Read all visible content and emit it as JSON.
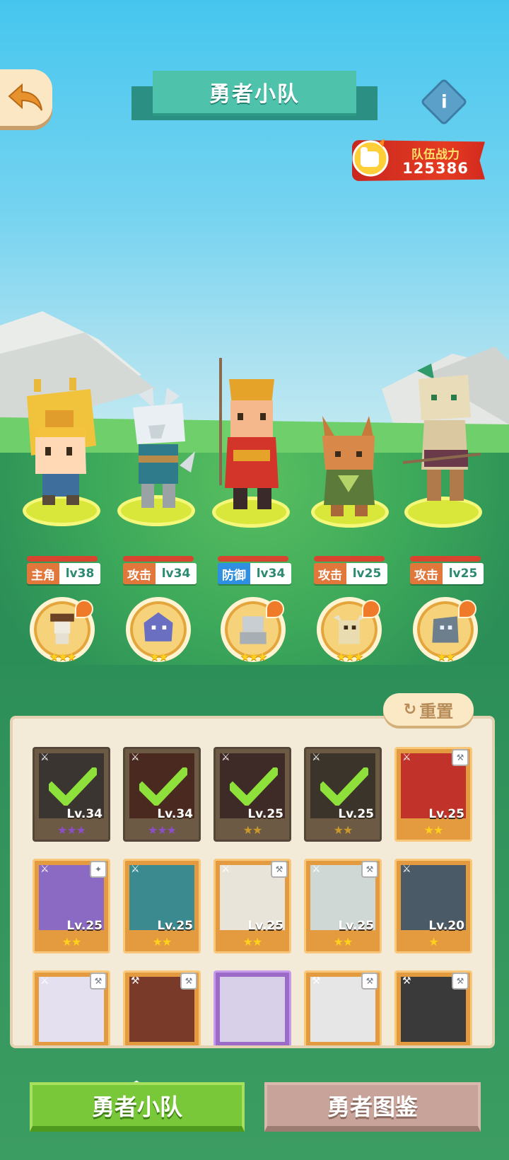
{
  "header": {
    "title": "勇者小队",
    "info_label": "i",
    "power_label": "队伍战力",
    "power_value": "125386"
  },
  "heroes": [
    {
      "role": "主角",
      "level": "lv38",
      "role_color": "#e1773b",
      "name_icon": "giraffe-hat-kid"
    },
    {
      "role": "攻击",
      "level": "lv34",
      "role_color": "#e1773b",
      "name_icon": "white-wolf-warrior"
    },
    {
      "role": "防御",
      "level": "lv34",
      "role_color": "#2f8fe0",
      "name_icon": "monkey-king"
    },
    {
      "role": "攻击",
      "level": "lv25",
      "role_color": "#e1773b",
      "name_icon": "fox-archer"
    },
    {
      "role": "攻击",
      "level": "lv25",
      "role_color": "#e1773b",
      "name_icon": "lynx-hunter"
    }
  ],
  "pets": [
    {
      "icon": "skeleton-cowboy-pet",
      "stars": "★★★"
    },
    {
      "icon": "purple-beast-pet",
      "stars": "★★"
    },
    {
      "icon": "silver-golem-pet",
      "stars": "★★★"
    },
    {
      "icon": "yak-pet",
      "stars": "★★★"
    },
    {
      "icon": "rock-golem-pet",
      "stars": "★★"
    }
  ],
  "panel": {
    "reset_label": "重置",
    "cards": [
      {
        "level": "Lv.34",
        "stars": "★★★",
        "selected": true,
        "star_color": "#8a4fc7"
      },
      {
        "level": "Lv.34",
        "stars": "★★★",
        "selected": true,
        "star_color": "#8a4fc7"
      },
      {
        "level": "Lv.25",
        "stars": "★★",
        "selected": true,
        "star_color": "#c99a2a"
      },
      {
        "level": "Lv.25",
        "stars": "★★",
        "selected": true,
        "star_color": "#c99a2a"
      },
      {
        "level": "Lv.25",
        "stars": "★★",
        "selected": false,
        "star_color": "#ffd11a"
      },
      {
        "level": "Lv.25",
        "stars": "★★",
        "selected": false,
        "star_color": "#ffd11a"
      },
      {
        "level": "Lv.25",
        "stars": "★★",
        "selected": false,
        "star_color": "#ffd11a"
      },
      {
        "level": "Lv.25",
        "stars": "★★",
        "selected": false,
        "star_color": "#ffd11a"
      },
      {
        "level": "Lv.25",
        "stars": "★★",
        "selected": false,
        "star_color": "#ffd11a"
      },
      {
        "level": "Lv.20",
        "stars": "★",
        "selected": false,
        "star_color": "#ffd11a"
      }
    ]
  },
  "bottom": {
    "team_tab": "勇者小队",
    "codex_tab": "勇者图鉴"
  },
  "colors": {
    "sky": "#46c6ee",
    "grass": "#3ca85a",
    "title_ribbon": "#4fc2ab",
    "power_red": "#e53b22",
    "team_button": "#78c83a",
    "codex_button": "#c7a39a"
  }
}
